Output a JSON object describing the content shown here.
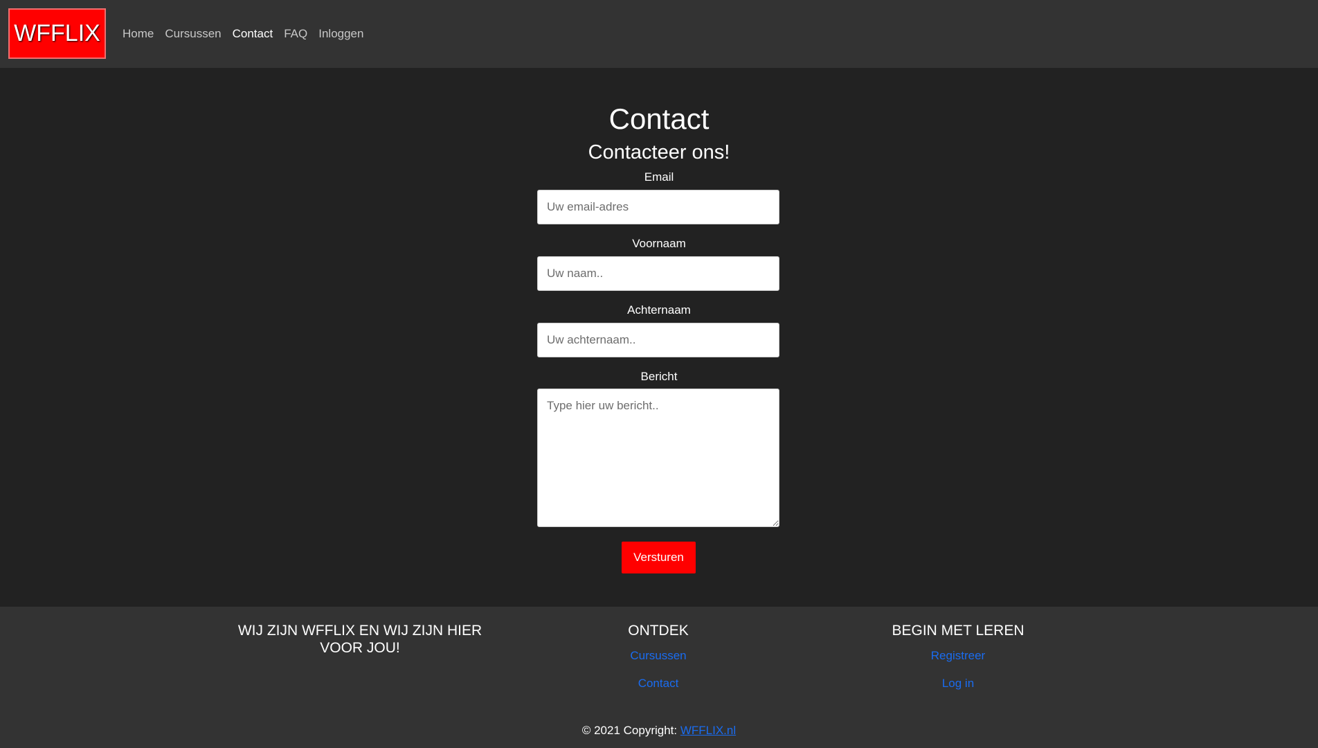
{
  "navbar": {
    "logo": "WFFLIX",
    "links": [
      {
        "label": "Home"
      },
      {
        "label": "Cursussen"
      },
      {
        "label": "Contact",
        "active": true
      },
      {
        "label": "FAQ"
      },
      {
        "label": "Inloggen"
      }
    ]
  },
  "contact": {
    "title": "Contact",
    "subtitle": "Contacteer ons!",
    "email_label": "Email",
    "email_placeholder": "Uw email-adres",
    "firstname_label": "Voornaam",
    "firstname_placeholder": "Uw naam..",
    "lastname_label": "Achternaam",
    "lastname_placeholder": "Uw achternaam..",
    "message_label": "Bericht",
    "message_placeholder": "Type hier uw bericht..",
    "submit_label": "Versturen"
  },
  "footer": {
    "about_heading": "WIJ ZIJN WFFLIX EN WIJ ZIJN HIER VOOR JOU!",
    "discover_heading": "ONTDEK",
    "discover_links": [
      "Cursussen",
      "Contact"
    ],
    "learn_heading": "BEGIN MET LEREN",
    "learn_links": [
      "Registreer",
      "Log in"
    ],
    "copyright_prefix": "© 2021 Copyright: ",
    "copyright_link": "WFFLIX.nl"
  },
  "colors": {
    "brand": "#ff0000",
    "background": "#222222",
    "panel": "#333333",
    "link": "#1a6cf0"
  }
}
